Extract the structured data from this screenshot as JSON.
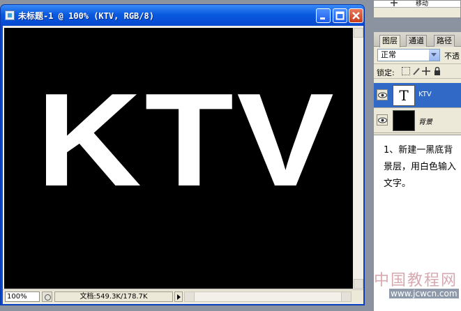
{
  "document": {
    "title": "未标题-1 @ 100% (KTV, RGB/8)",
    "canvas_text": "KTV",
    "zoom": "100%",
    "doc_size": "文档:549.3K/178.7K"
  },
  "history": {
    "item_label": "移动"
  },
  "layers_panel": {
    "tabs": [
      "图层",
      "通道",
      "路径"
    ],
    "blend_mode": "正常",
    "opacity_label": "不透",
    "lock_label": "锁定:",
    "layers": [
      {
        "name": "KTV",
        "thumb": "T",
        "selected": true
      },
      {
        "name": "背景",
        "thumb": "",
        "selected": false
      }
    ]
  },
  "note": {
    "text": "1、新建一黑底背景层，用白色输入文字。"
  },
  "watermark": {
    "cn": "中国教程网",
    "url": "www.jcwcn.com"
  },
  "colors": {
    "titlebar": "#0a5ae0",
    "selection": "#3169c6",
    "canvas": "#000000",
    "text": "#ffffff"
  }
}
